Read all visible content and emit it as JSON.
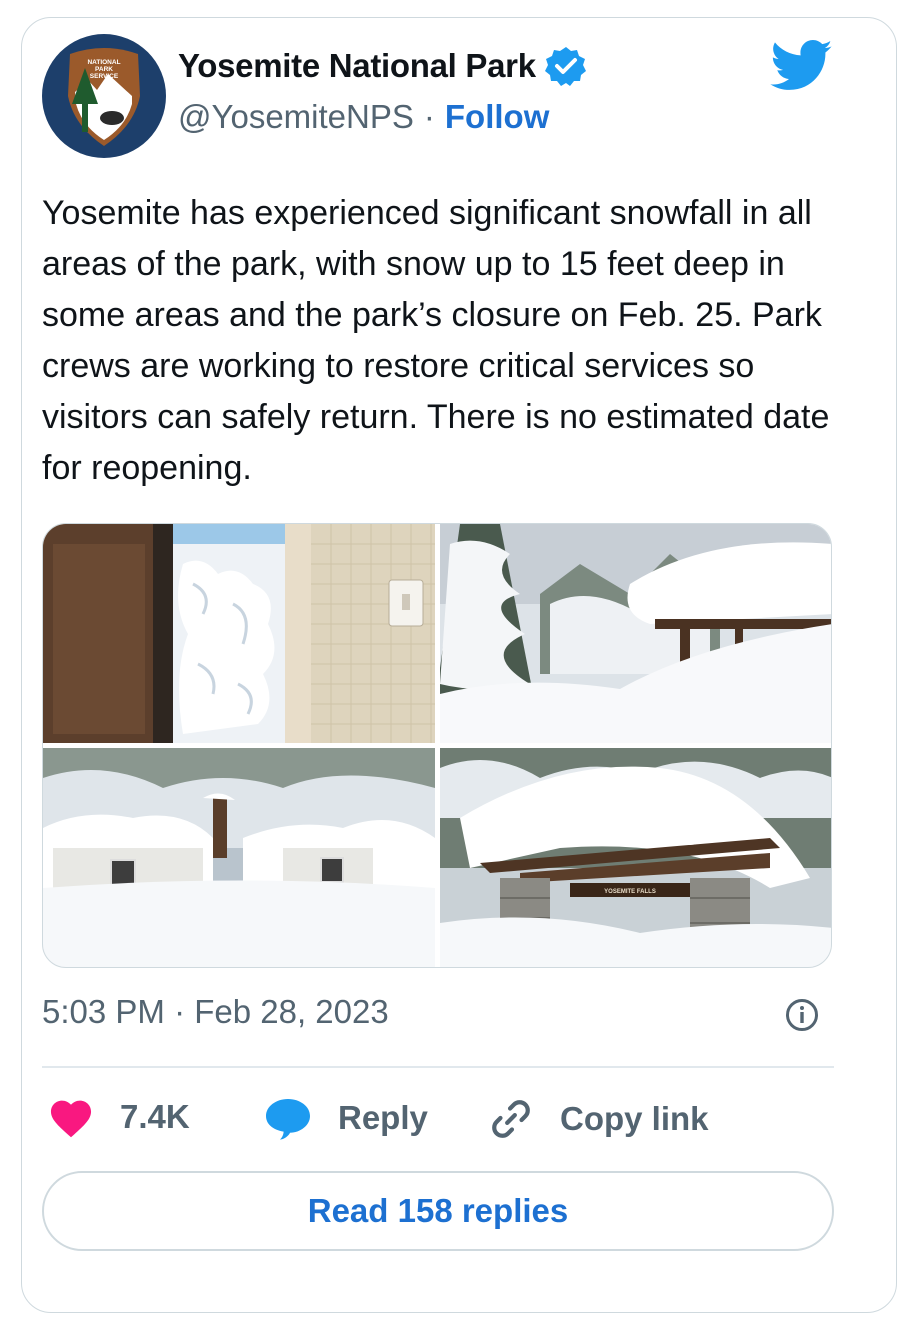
{
  "tweet": {
    "author": {
      "name": "Yosemite National Park",
      "handle": "@YosemiteNPS",
      "follow_label": "Follow",
      "verified": true,
      "avatar_text": [
        "NATIONAL",
        "PARK",
        "SERVICE"
      ]
    },
    "brand_icon": "twitter-bird-icon",
    "text": "Yosemite has experienced significant snowfall in all areas of the park, with snow up to 15 feet deep in some areas and the park’s closure on Feb. 25. Park crews are working to restore critical services so visitors can safely return. There is no estimated date for reopening.",
    "media": [
      {
        "name": "snow-blocked-doorway-photo"
      },
      {
        "name": "snow-covered-shelter-photo"
      },
      {
        "name": "buried-cabins-photo"
      },
      {
        "name": "yosemite-falls-shelter-photo",
        "sign_text": "YOSEMITE FALLS"
      }
    ],
    "timestamp": "5:03 PM · Feb 28, 2023",
    "actions": {
      "like_count": "7.4K",
      "reply_label": "Reply",
      "copy_link_label": "Copy link"
    },
    "read_replies_label": "Read 158 replies"
  },
  "colors": {
    "accent": "#1d70d1",
    "twitter_blue": "#1d9bf0",
    "like": "#f91880",
    "secondary_text": "#536471",
    "border": "#cfd9de"
  }
}
